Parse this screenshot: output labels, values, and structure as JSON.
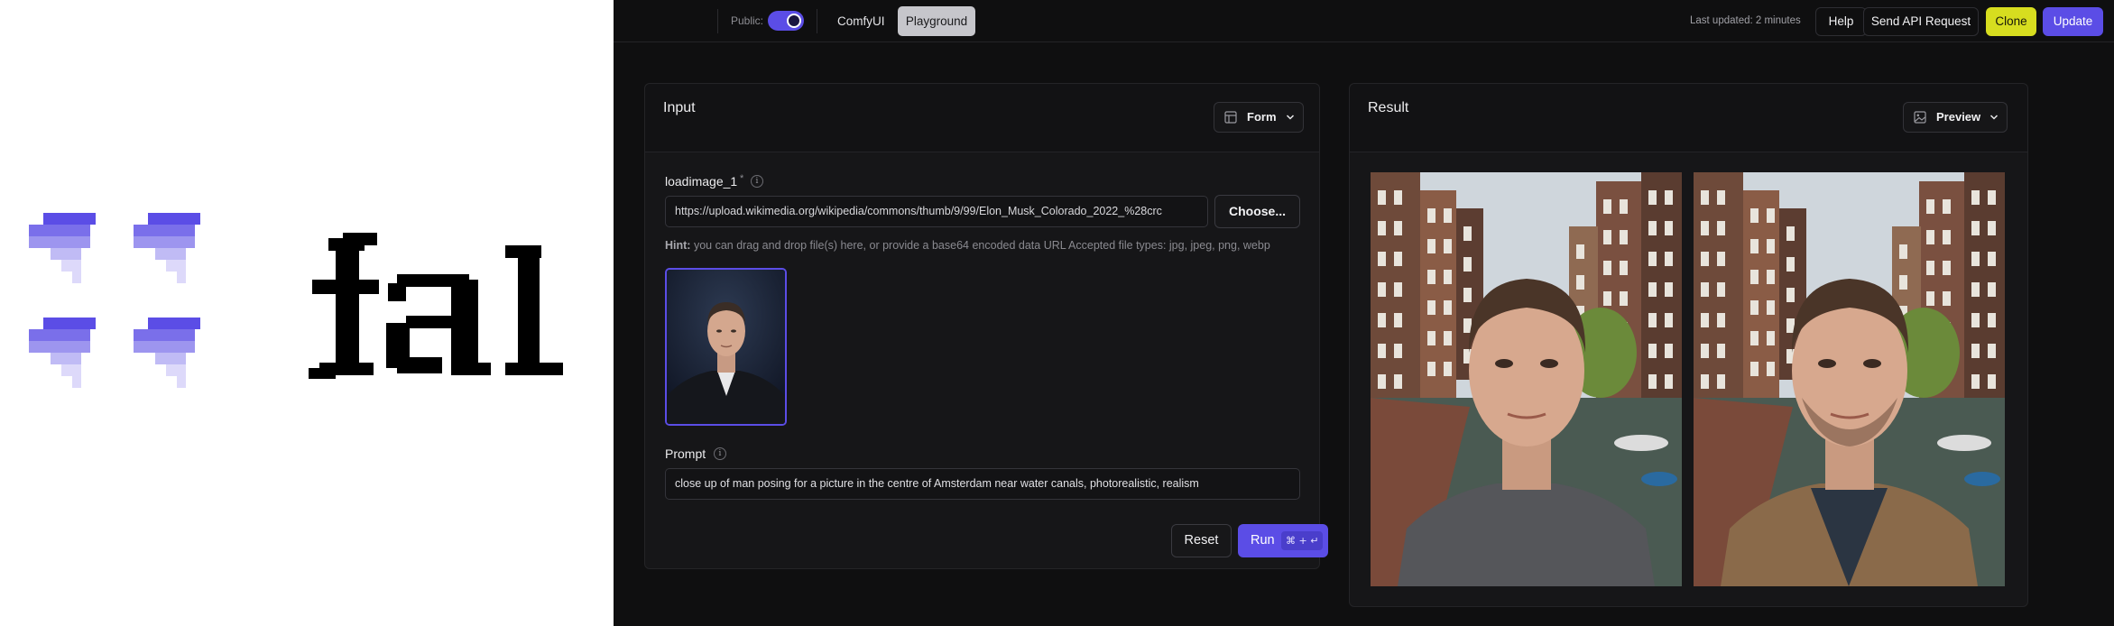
{
  "colors": {
    "accent": "#5b4de6",
    "clone_yellow": "#d7dd1f",
    "background": "#0f0f10",
    "logo_purple_shades": [
      "#5b4de6",
      "#7a6fea",
      "#9d95ef",
      "#c0bbf5",
      "#ddd9fa"
    ]
  },
  "logo": {
    "wordmark": "fal"
  },
  "topbar": {
    "public_label": "Public:",
    "public_toggle_on": true,
    "tabs": [
      {
        "label": "ComfyUI",
        "active": false
      },
      {
        "label": "Playground",
        "active": true
      }
    ],
    "last_updated": "Last updated: 2 minutes",
    "help_label": "Help",
    "api_label": "Send API Request",
    "clone_label": "Clone",
    "update_label": "Update"
  },
  "input_panel": {
    "title": "Input",
    "view_select": {
      "label": "Form",
      "icon": "form-layout-icon"
    },
    "image_field": {
      "label": "loadimage_1",
      "required_marker": "*",
      "value": "https://upload.wikimedia.org/wikipedia/commons/thumb/9/99/Elon_Musk_Colorado_2022_%28crc",
      "choose_label": "Choose...",
      "hint_prefix": "Hint:",
      "hint_text": " you can drag and drop file(s) here, or provide a base64 encoded data URL Accepted file types: jpg, jpeg, png, webp"
    },
    "prompt_field": {
      "label": "Prompt",
      "value": "close up of man posing for a picture in the centre of Amsterdam near water canals, photorealistic, realism"
    },
    "reset_label": "Reset",
    "run_label": "Run",
    "run_shortcut": "⌘ + ↵"
  },
  "result_panel": {
    "title": "Result",
    "view_select": {
      "label": "Preview",
      "icon": "image-icon"
    },
    "images": [
      {
        "shirt_color": "#55565a",
        "jacket_color": ""
      },
      {
        "shirt_color": "#2b3542",
        "jacket_color": "#8a6a4a"
      }
    ]
  }
}
